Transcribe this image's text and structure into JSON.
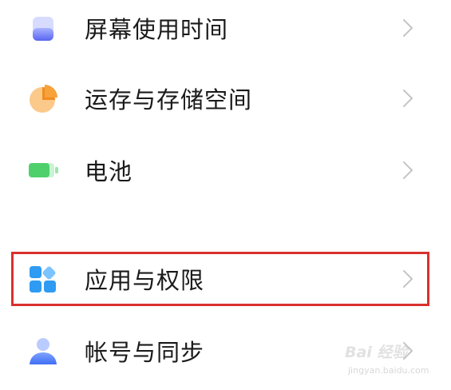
{
  "settings": {
    "items": [
      {
        "label": "屏幕使用时间",
        "icon": "screen-time-icon",
        "color": "#5b6cf0"
      },
      {
        "label": "运存与存储空间",
        "icon": "storage-pie-icon",
        "color": "#f5a13a"
      },
      {
        "label": "电池",
        "icon": "battery-icon",
        "color": "#4fd06d"
      },
      {
        "label": "应用与权限",
        "icon": "apps-icon",
        "color": "#2f9bf3"
      },
      {
        "label": "帐号与同步",
        "icon": "account-icon",
        "color": "#3f6ef5"
      }
    ],
    "highlighted_item": "应用与权限",
    "highlight_color": "#d9312e"
  },
  "watermark": {
    "title": "Bai 经验",
    "url": "jingyan.baidu.com"
  }
}
